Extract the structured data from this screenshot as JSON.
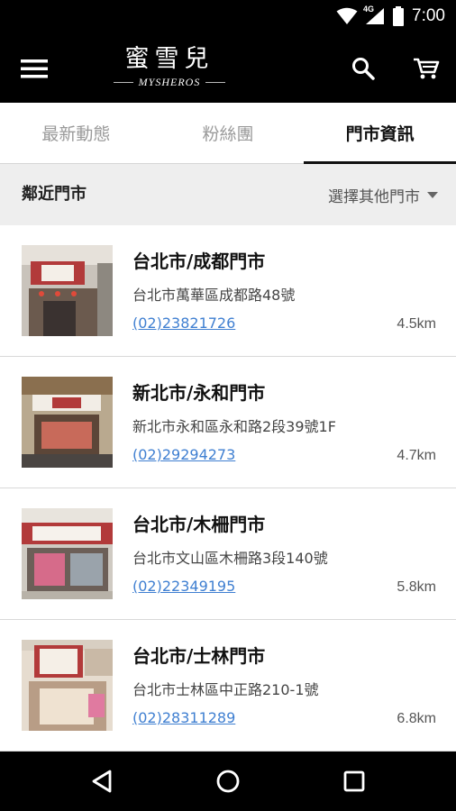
{
  "status_bar": {
    "time": "7:00",
    "network": "4G",
    "icons": [
      "wifi-icon",
      "cellular-signal-icon",
      "battery-icon"
    ]
  },
  "app_bar": {
    "logo_text": "蜜雪兒",
    "logo_subtext": "MYSHEROS",
    "icons": [
      "menu-icon",
      "search-icon",
      "cart-icon"
    ]
  },
  "tabs": [
    {
      "label": "最新動態",
      "active": false
    },
    {
      "label": "粉絲團",
      "active": false
    },
    {
      "label": "門市資訊",
      "active": true
    }
  ],
  "subheader": {
    "title": "鄰近門市",
    "select_label": "選擇其他門市"
  },
  "stores": [
    {
      "name": "台北市/成都門市",
      "address": "台北市萬華區成都路48號",
      "phone": "(02)23821726",
      "distance": "4.5km"
    },
    {
      "name": "新北市/永和門市",
      "address": "新北市永和區永和路2段39號1F",
      "phone": "(02)29294273",
      "distance": "4.7km"
    },
    {
      "name": "台北市/木柵門市",
      "address": "台北市文山區木柵路3段140號",
      "phone": "(02)22349195",
      "distance": "5.8km"
    },
    {
      "name": "台北市/士林門市",
      "address": "台北市士林區中正路210-1號",
      "phone": "(02)28311289",
      "distance": "6.8km"
    }
  ],
  "nav_bar": {
    "icons": [
      "back-icon",
      "home-icon",
      "recents-icon"
    ]
  },
  "colors": {
    "app_bar": "#000000",
    "link": "#3f7fd1",
    "subheader_bg": "#eeeeee",
    "active_tab": "#111111",
    "inactive_tab": "#9a9a9a"
  }
}
